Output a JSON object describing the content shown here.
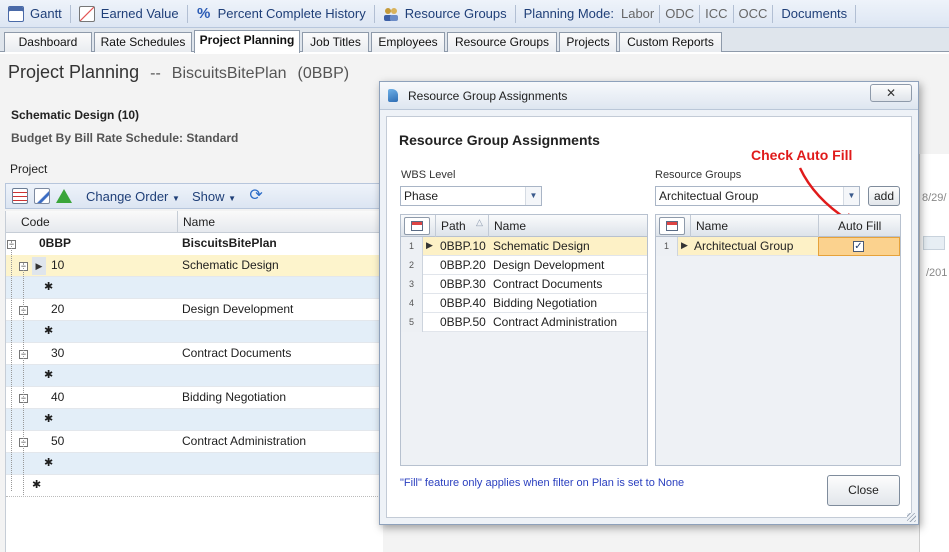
{
  "toolbar": {
    "items": [
      {
        "label": "Gantt",
        "icon": "gantt-icon"
      },
      {
        "label": "Earned Value",
        "icon": "earned-value-icon"
      },
      {
        "label": "Percent Complete History",
        "icon": "percent-icon"
      },
      {
        "label": "Resource Groups",
        "icon": "resource-groups-icon"
      }
    ],
    "planning_mode_label": "Planning Mode:",
    "planning_modes": [
      "Labor",
      "ODC",
      "ICC",
      "OCC"
    ],
    "documents_label": "Documents"
  },
  "tabs": [
    "Dashboard",
    "Rate Schedules",
    "Project Planning",
    "Job Titles",
    "Employees",
    "Resource Groups",
    "Projects",
    "Custom Reports"
  ],
  "page": {
    "title": "Project Planning",
    "separator": "--",
    "plan_name": "BiscuitsBitePlan",
    "plan_code": "(0BBP)",
    "phase_name": "Schematic Design (10)",
    "budget_line": "Budget By Bill Rate Schedule: Standard",
    "project_label": "Project"
  },
  "project_bar": {
    "change_order": "Change Order",
    "show": "Show"
  },
  "left_grid": {
    "headers": {
      "code": "Code",
      "name": "Name"
    },
    "root": {
      "code": "0BBP",
      "name": "BiscuitsBitePlan"
    },
    "rows": [
      {
        "code": "10",
        "name": "Schematic Design"
      },
      {
        "code": "20",
        "name": "Design Development"
      },
      {
        "code": "30",
        "name": "Contract Documents"
      },
      {
        "code": "40",
        "name": "Bidding Negotiation"
      },
      {
        "code": "50",
        "name": "Contract Administration"
      }
    ],
    "new_row_symbol": "✱"
  },
  "dialog": {
    "window_title": "Resource Group Assignments",
    "heading": "Resource Group Assignments",
    "wbs_label": "WBS Level",
    "wbs_value": "Phase",
    "rg_label": "Resource Groups",
    "rg_value": "Architectual Group",
    "add_label": "add",
    "annotation": "Check Auto Fill",
    "wbs_grid": {
      "headers": {
        "path": "Path",
        "name": "Name"
      },
      "rows": [
        {
          "num": "1",
          "path": "0BBP.10",
          "name": "Schematic Design"
        },
        {
          "num": "2",
          "path": "0BBP.20",
          "name": "Design Development"
        },
        {
          "num": "3",
          "path": "0BBP.30",
          "name": "Contract Documents"
        },
        {
          "num": "4",
          "path": "0BBP.40",
          "name": "Bidding Negotiation"
        },
        {
          "num": "5",
          "path": "0BBP.50",
          "name": "Contract Administration"
        }
      ]
    },
    "rg_grid": {
      "headers": {
        "name": "Name",
        "autofill": "Auto Fill"
      },
      "rows": [
        {
          "num": "1",
          "name": "Architectual Group",
          "autofill": true
        }
      ]
    },
    "footnote": "\"Fill\" feature only applies when filter on Plan is set to None",
    "close_label": "Close"
  },
  "right_partial": {
    "date_fragment": "8/29/",
    "year_fragment": "/201"
  },
  "colors": {
    "toolbar_text": "#1f3f78",
    "annotation": "#e01b1b",
    "selected_row": "#fdf1c6",
    "new_row": "#e3eef8"
  }
}
